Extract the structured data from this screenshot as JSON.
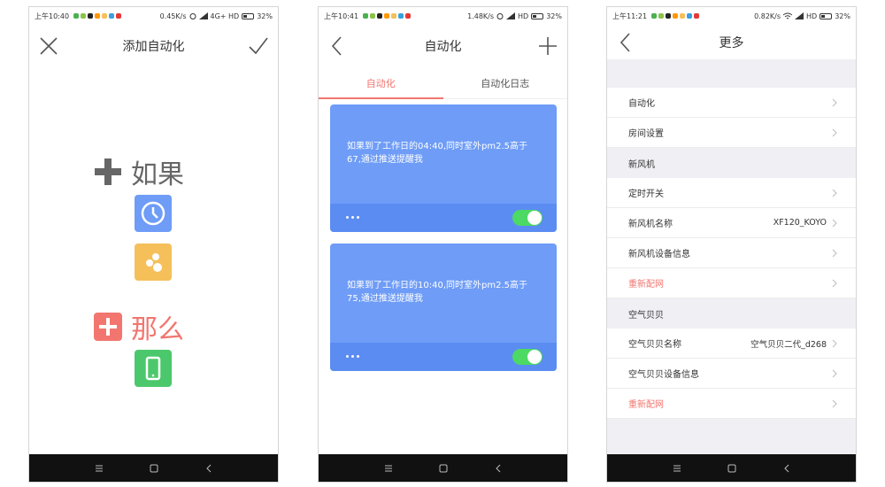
{
  "colors": {
    "accent_red": "#f2766f",
    "card_blue": "#6e9cf7",
    "card_footer_blue": "#5b8cf2",
    "toggle_green": "#4cd964",
    "nav_bar": "#111111",
    "settings_bg": "#efeff4"
  },
  "screen1": {
    "status": {
      "time": "上午10:40",
      "speed": "0.45K/s",
      "network": "4G+ HD",
      "battery": "32%"
    },
    "title": "添加自动化",
    "close_icon": "close-icon",
    "confirm_icon": "check-icon",
    "if_label": "如果",
    "then_label": "那么",
    "tiles": [
      {
        "icon": "clock-icon",
        "color": "#6e9cf7"
      },
      {
        "icon": "sensor-icon",
        "color": "#f5c05a"
      },
      {
        "icon": "phone-icon",
        "color": "#4cc86c"
      }
    ]
  },
  "screen2": {
    "status": {
      "time": "上午10:41",
      "speed": "1.48K/s",
      "network": "HD",
      "battery": "32%"
    },
    "title": "自动化",
    "tabs": [
      "自动化",
      "自动化日志"
    ],
    "active_tab": 0,
    "cards": [
      {
        "text": "如果到了工作日的04:40,同时室外pm2.5高于67,通过推送提醒我",
        "enabled": true
      },
      {
        "text": "如果到了工作日的10:40,同时室外pm2.5高于75,通过推送提醒我",
        "enabled": true
      }
    ]
  },
  "screen3": {
    "status": {
      "time": "上午11:21",
      "speed": "0.82K/s",
      "network": "HD",
      "battery": "32%"
    },
    "title": "更多",
    "group1": [
      {
        "label": "自动化",
        "value": ""
      },
      {
        "label": "房间设置",
        "value": ""
      }
    ],
    "section_xinfeng": "新风机",
    "group2": [
      {
        "label": "定时开关",
        "value": ""
      },
      {
        "label": "新风机名称",
        "value": "XF120_KOYO"
      },
      {
        "label": "新风机设备信息",
        "value": ""
      },
      {
        "label": "重新配网",
        "value": ""
      }
    ],
    "section_kongqi": "空气贝贝",
    "group3": [
      {
        "label": "空气贝贝名称",
        "value": "空气贝贝二代_d268"
      },
      {
        "label": "空气贝贝设备信息",
        "value": ""
      },
      {
        "label": "重新配网",
        "value": ""
      }
    ]
  }
}
